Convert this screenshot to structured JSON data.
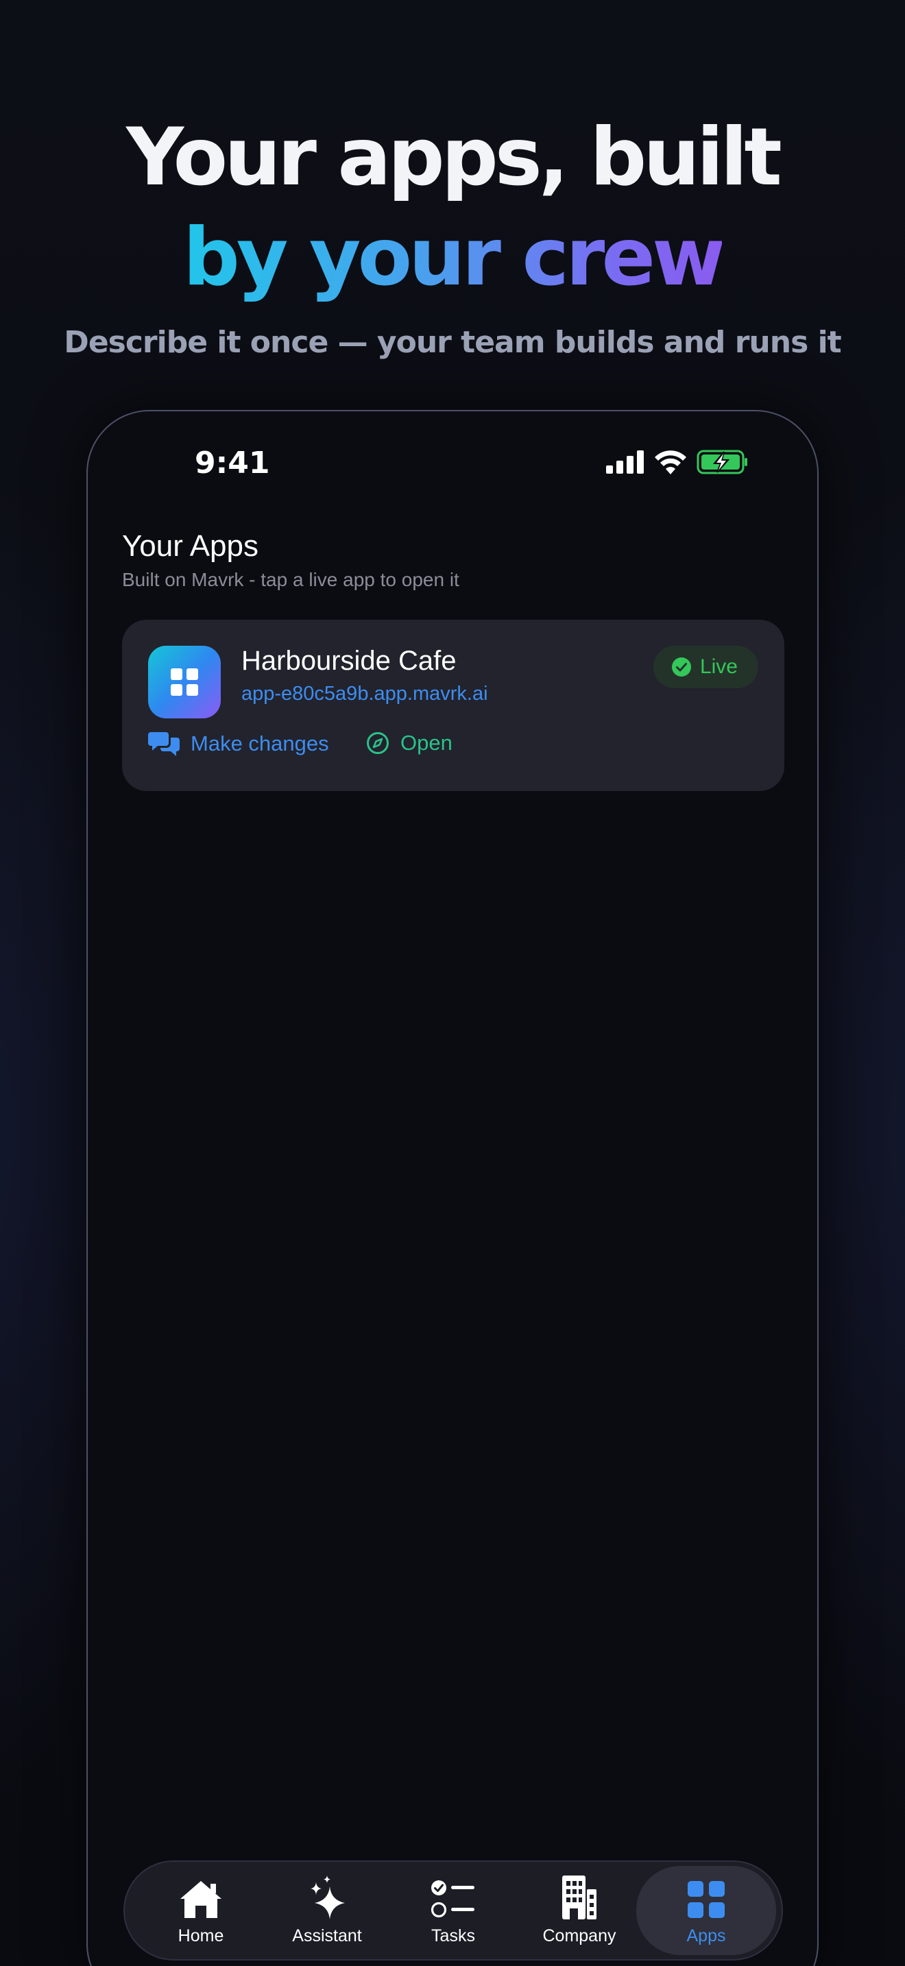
{
  "hero": {
    "line1": "Your apps, built",
    "line2": "by your crew",
    "subtitle": "Describe it once — your team builds and runs it"
  },
  "status_bar": {
    "time": "9:41",
    "icons": [
      "signal-icon",
      "wifi-icon",
      "battery-charging-icon"
    ]
  },
  "screen": {
    "title": "Your Apps",
    "subtitle": "Built on Mavrk - tap a live app to open it"
  },
  "apps": [
    {
      "name": "Harbourside Cafe",
      "url": "app-e80c5a9b.app.mavrk.ai",
      "status": "Live",
      "actions": {
        "changes_label": "Make changes",
        "open_label": "Open"
      }
    }
  ],
  "tab_bar": {
    "items": [
      {
        "label": "Home",
        "icon": "house-icon"
      },
      {
        "label": "Assistant",
        "icon": "sparkles-icon"
      },
      {
        "label": "Tasks",
        "icon": "checklist-icon"
      },
      {
        "label": "Company",
        "icon": "building-icon"
      },
      {
        "label": "Apps",
        "icon": "grid-icon"
      }
    ],
    "active": "Apps"
  },
  "colors": {
    "accent_blue": "#3d8df0",
    "live_green": "#34c759",
    "open_teal": "#2ac28a",
    "gradient_start": "#22c5ea",
    "gradient_end": "#8a5cf0"
  }
}
